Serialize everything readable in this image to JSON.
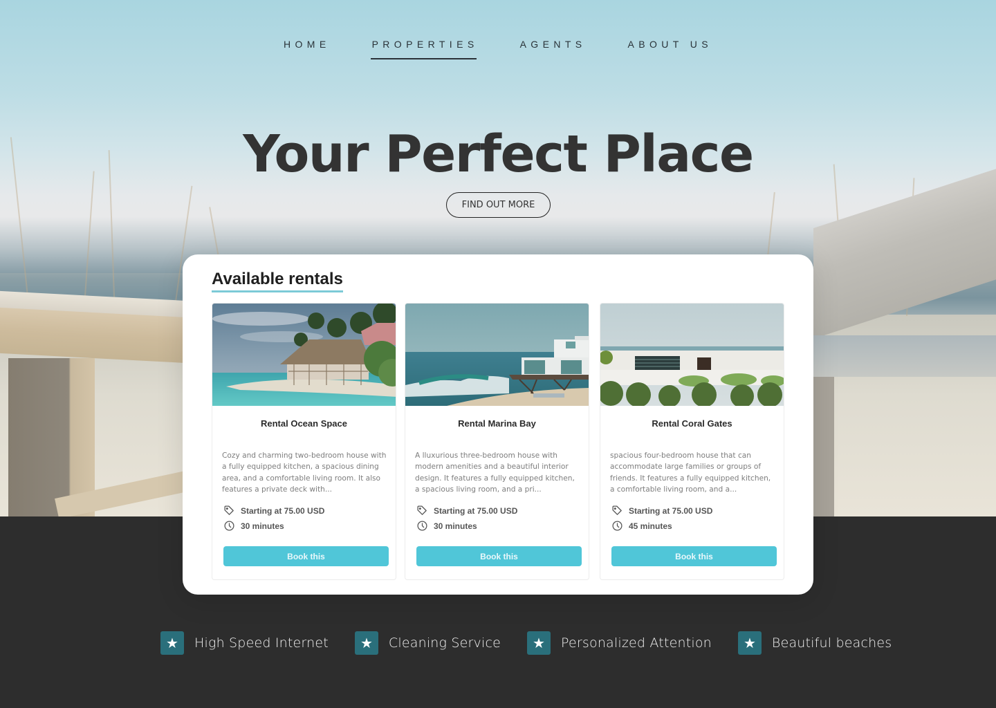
{
  "nav": {
    "items": [
      {
        "label": "HOME",
        "active": false
      },
      {
        "label": "PROPERTIES",
        "active": true
      },
      {
        "label": "AGENTS",
        "active": false
      },
      {
        "label": "ABOUT US",
        "active": false
      }
    ]
  },
  "hero": {
    "title": "Your Perfect Place",
    "cta_label": "FIND OUT MORE"
  },
  "rentals": {
    "title": "Available rentals",
    "cards": [
      {
        "name": "Rental Ocean Space",
        "image": "beach-bungalow-photo",
        "description": "Cozy and charming two-bedroom house with a fully equipped kitchen, a spacious dining area, and a comfortable living room. It also features a private deck with...",
        "price": "Starting at 75.00 USD",
        "duration": "30 minutes",
        "button_label": "Book this"
      },
      {
        "name": "Rental Marina Bay",
        "image": "beach-house-waves-photo",
        "description": "A lluxurious three-bedroom house with modern amenities and a beautiful interior design. It features a fully equipped kitchen, a spacious living room, and a pri...",
        "price": "Starting at 75.00 USD",
        "duration": "30 minutes",
        "button_label": "Book this"
      },
      {
        "name": "Rental Coral Gates",
        "image": "white-villa-photo",
        "description": "spacious four-bedroom house that can accommodate large families or groups of friends. It features a fully equipped kitchen, a comfortable living room, and a...",
        "price": "Starting at 75.00 USD",
        "duration": "45 minutes",
        "button_label": "Book this"
      }
    ]
  },
  "features": [
    {
      "icon": "star-icon",
      "label": "High Speed Internet"
    },
    {
      "icon": "star-icon",
      "label": "Cleaning Service"
    },
    {
      "icon": "star-icon",
      "label": "Personalized Attention"
    },
    {
      "icon": "star-icon",
      "label": "Beautiful beaches"
    }
  ],
  "colors": {
    "accent": "#50c6d8",
    "feature_icon_bg": "#2a6f7b",
    "dark_bg": "#2d2d2d",
    "title_underline": "#7ccad7"
  }
}
